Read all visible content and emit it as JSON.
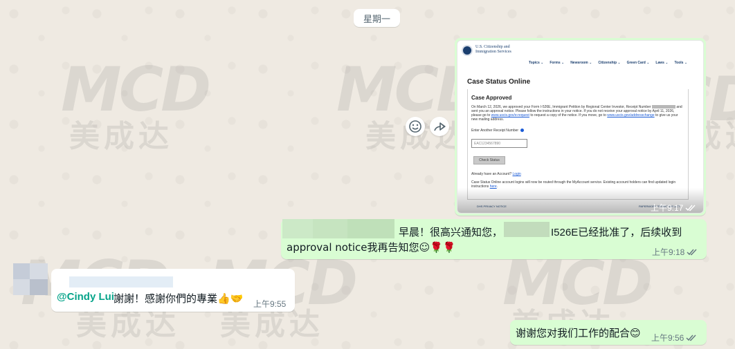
{
  "date_separator": "星期一",
  "image_message": {
    "time": "上午9:17",
    "screenshot": {
      "agency": "U.S. Citizenship and Immigration Services",
      "nav": [
        "Topics ⌄",
        "Forms ⌄",
        "Newsroom ⌄",
        "Citizenship ⌄",
        "Green Card ⌄",
        "Laws ⌄",
        "Tools ⌄"
      ],
      "heading": "Case Status Online",
      "status": "Case Approved",
      "paragraph_start": "On March 12, 2026, we approved your Form I-526E, Immigrant Petition by Regional Center Investor, Receipt Number",
      "paragraph_mid": "and sent you an approval notice. Please follow the instructions in your notice. If you do not receive your approval notice by April 11, 2026, please go to",
      "link1": "www.uscis.gov/e-request",
      "paragraph_mid2": "to request a copy of the notice. If you move, go to",
      "link2": "www.uscis.gov/addresschange",
      "paragraph_end": "to give us your new mailing address.",
      "receipt_label": "Enter Another Receipt Number",
      "receipt_placeholder": "EAC1234567890",
      "check_button": "Check Status",
      "account_question": "Already have an Account?",
      "login_link": "Login",
      "account_note": "Case Status Online account logins will now be routed through the MyAccount service. Existing account holders can find updated login instructions",
      "here_link": "here",
      "footer_left": "DHS PRIVACY NOTICE",
      "footer_right": "PAPERWORK REDUCTION ACT"
    }
  },
  "message_1": {
    "line1_a": "早晨！很高兴通知您，",
    "line1_b": "I526E已经批准了，后续收到",
    "line2": "approval notice我再告知您☺🌹🌹",
    "time": "上午9:18"
  },
  "message_2": {
    "mention": "@Cindy Lui",
    "text": "謝謝！感謝你們的專業👍🤝",
    "time": "上午9:55"
  },
  "message_3": {
    "text": "谢谢您对我们工作的配合😊",
    "time": "上午9:56"
  },
  "watermark": {
    "latin": "MCD",
    "chinese": "美成达"
  },
  "colors": {
    "outgoing_bubble": "#d9fdd3",
    "incoming_bubble": "#ffffff",
    "chat_background": "#efeae2",
    "mention": "#06a48a",
    "read_ticks": "#53bdeb"
  }
}
